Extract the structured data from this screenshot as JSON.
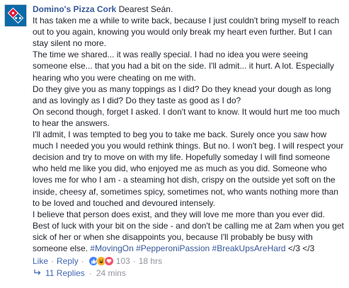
{
  "comment": {
    "author": "Domino's Pizza Cork",
    "paragraphs": [
      "Dearest Seán.",
      "It has taken me a while to write back, because I just couldn't bring myself to reach out to you again, knowing you would only break my heart even further. But I can stay silent no more.",
      "The time we shared... it was really special. I had no idea you were seeing someone else... that you had a bit on the side. I'll admit... it hurt. A lot. Especially hearing who you were cheating on me with.",
      "Do they give you as many toppings as I did? Do they knead your dough as long and as lovingly as I did? Do they taste as good as I do?",
      "On second though, forget I asked. I don't want to know. It would hurt me too much to hear the answers.",
      "I'll admit, I was tempted to beg you to take me back. Surely once you saw how much I needed you you would rethink things. But no. I won't beg. I will respect your decision and try to move on with my life. Hopefully someday I will find someone who held me like you did, who enjoyed me as much as you did. Someone who loves me for who I am - a steaming hot dish, crispy on the outside yet soft on the inside, cheesy af, sometimes spicy, sometimes not, who wants nothing more than to be loved and touched and devoured intensely.",
      "I believe that person does exist, and they will love me more than you ever did. Best of luck with your bit on the side - and don't be calling me at 2am when you get sick of her or when she disappoints you, because I'll probably be busy with someone else."
    ],
    "hashtags": [
      "#MovingOn",
      "#PepperoniPassion",
      "#BreakUpsAreHard"
    ],
    "closing": "</3 </3"
  },
  "actions": {
    "like": "Like",
    "separator": "·",
    "reply": "Reply",
    "reaction_count": "103",
    "time": "18 hrs"
  },
  "replies": {
    "label": "11 Replies",
    "separator": "·",
    "time": "24 mins"
  },
  "colors": {
    "link": "#365899",
    "action": "#4267b2",
    "meta": "#90949c",
    "text": "#1d2129",
    "brand_blue": "#0b6aa8",
    "brand_red": "#e31837"
  }
}
